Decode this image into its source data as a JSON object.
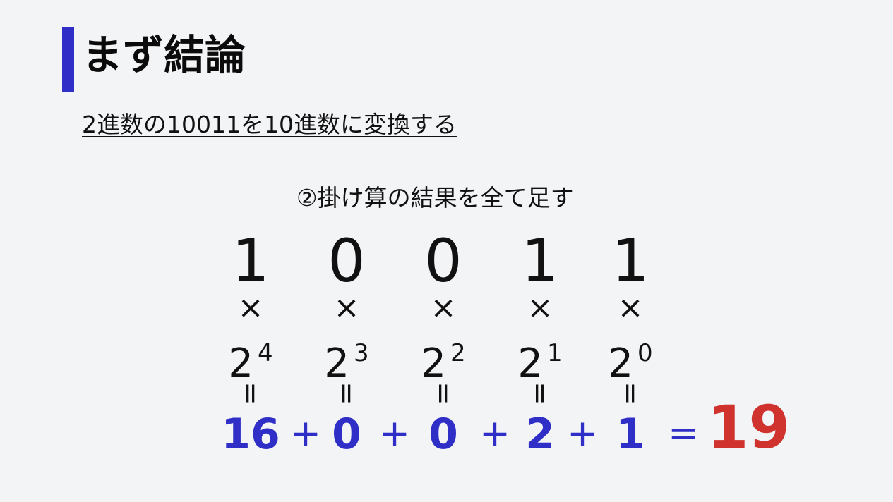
{
  "colors": {
    "accent": "#2f2fc8",
    "total": "#d0322e",
    "background": "#f3f4f6"
  },
  "title": "まず結論",
  "subtitle": "2進数の10011を10進数に変換する",
  "step_caption": "②掛け算の結果を全て足す",
  "times_symbol": "×",
  "equals_vertical_symbol": "=",
  "plus_symbol": "+",
  "equals_symbol": "=",
  "columns": [
    {
      "digit": "1",
      "base": "2",
      "exponent": "4",
      "product": "16"
    },
    {
      "digit": "0",
      "base": "2",
      "exponent": "3",
      "product": "0"
    },
    {
      "digit": "0",
      "base": "2",
      "exponent": "2",
      "product": "0"
    },
    {
      "digit": "1",
      "base": "2",
      "exponent": "1",
      "product": "2"
    },
    {
      "digit": "1",
      "base": "2",
      "exponent": "0",
      "product": "1"
    }
  ],
  "total": "19"
}
